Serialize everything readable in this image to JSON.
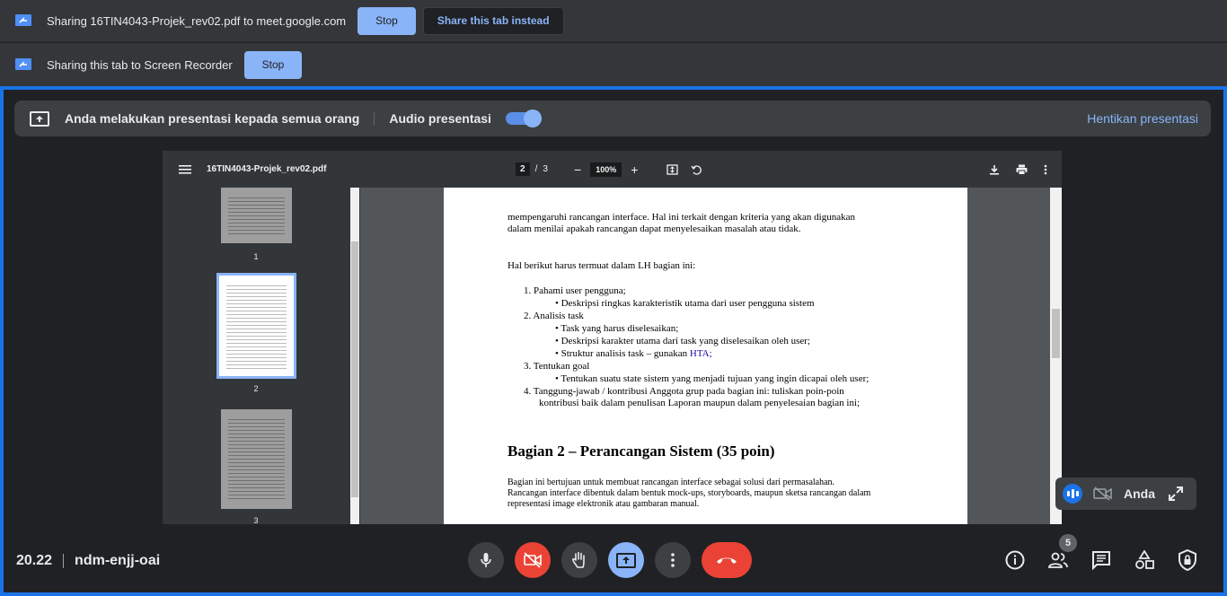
{
  "share_bar_1": {
    "text": "Sharing 16TIN4043-Projek_rev02.pdf to meet.google.com",
    "stop_label": "Stop",
    "share_instead_label": "Share this tab instead"
  },
  "share_bar_2": {
    "text": "Sharing this tab to Screen Recorder",
    "stop_label": "Stop"
  },
  "banner": {
    "presenting_text": "Anda melakukan presentasi kepada semua orang",
    "audio_label": "Audio presentasi",
    "audio_on": true,
    "stop_label": "Hentikan presentasi"
  },
  "pdf": {
    "filename": "16TIN4043-Projek_rev02.pdf",
    "current_page": "2",
    "page_sep": "/",
    "total_pages": "3",
    "zoom": "100%",
    "thumbnails": [
      "1",
      "2",
      "3"
    ],
    "content": {
      "intro_1": "mempengaruhi rancangan interface. Hal ini terkait dengan kriteria yang akan digunakan",
      "intro_2": "dalam menilai apakah rancangan dapat menyelesaikan masalah atau tidak.",
      "lead": "Hal berikut harus termuat dalam LH bagian ini:",
      "item1": "1.    Pahami user pengguna;",
      "item1a": "•    Deskripsi ringkas karakteristik utama dari user pengguna sistem",
      "item2": "2.    Analisis task",
      "item2a": "•    Task yang harus diselesaikan;",
      "item2b": "•    Deskripsi karakter utama dari task yang diselesaikan oleh user;",
      "item2c": "•    Struktur analisis task – gunakan ",
      "item2c_link": "HTA;",
      "item3": "3.    Tentukan goal",
      "item3a": "•    Tentukan suatu state sistem yang menjadi tujuan yang ingin dicapai oleh user;",
      "item4": "4.    Tanggung-jawab / kontribusi Anggota grup pada bagian ini: tuliskan poin-poin",
      "item4b": "kontribusi baik dalam penulisan Laporan maupun dalam penyelesaian bagian ini;",
      "heading": "Bagian 2 – Perancangan Sistem (35 poin)",
      "para1": "Bagian ini bertujuan untuk membuat rancangan interface sebagai solusi dari permasalahan.",
      "para2": "Rancangan interface dibentuk dalam bentuk mock-ups, storyboards, maupun sketsa rancangan dalam",
      "para3": "representasi image elektronik atau gambaran manual."
    }
  },
  "self_tile": {
    "name": "Anda"
  },
  "bottom": {
    "time": "20.22",
    "meeting_code": "ndm-enjj-oai",
    "participant_count": "5"
  },
  "colors": {
    "accent": "#8ab4f8",
    "end_call": "#ea4335",
    "camera_off": "#ea4335",
    "present_active": "#8ab4f8"
  }
}
